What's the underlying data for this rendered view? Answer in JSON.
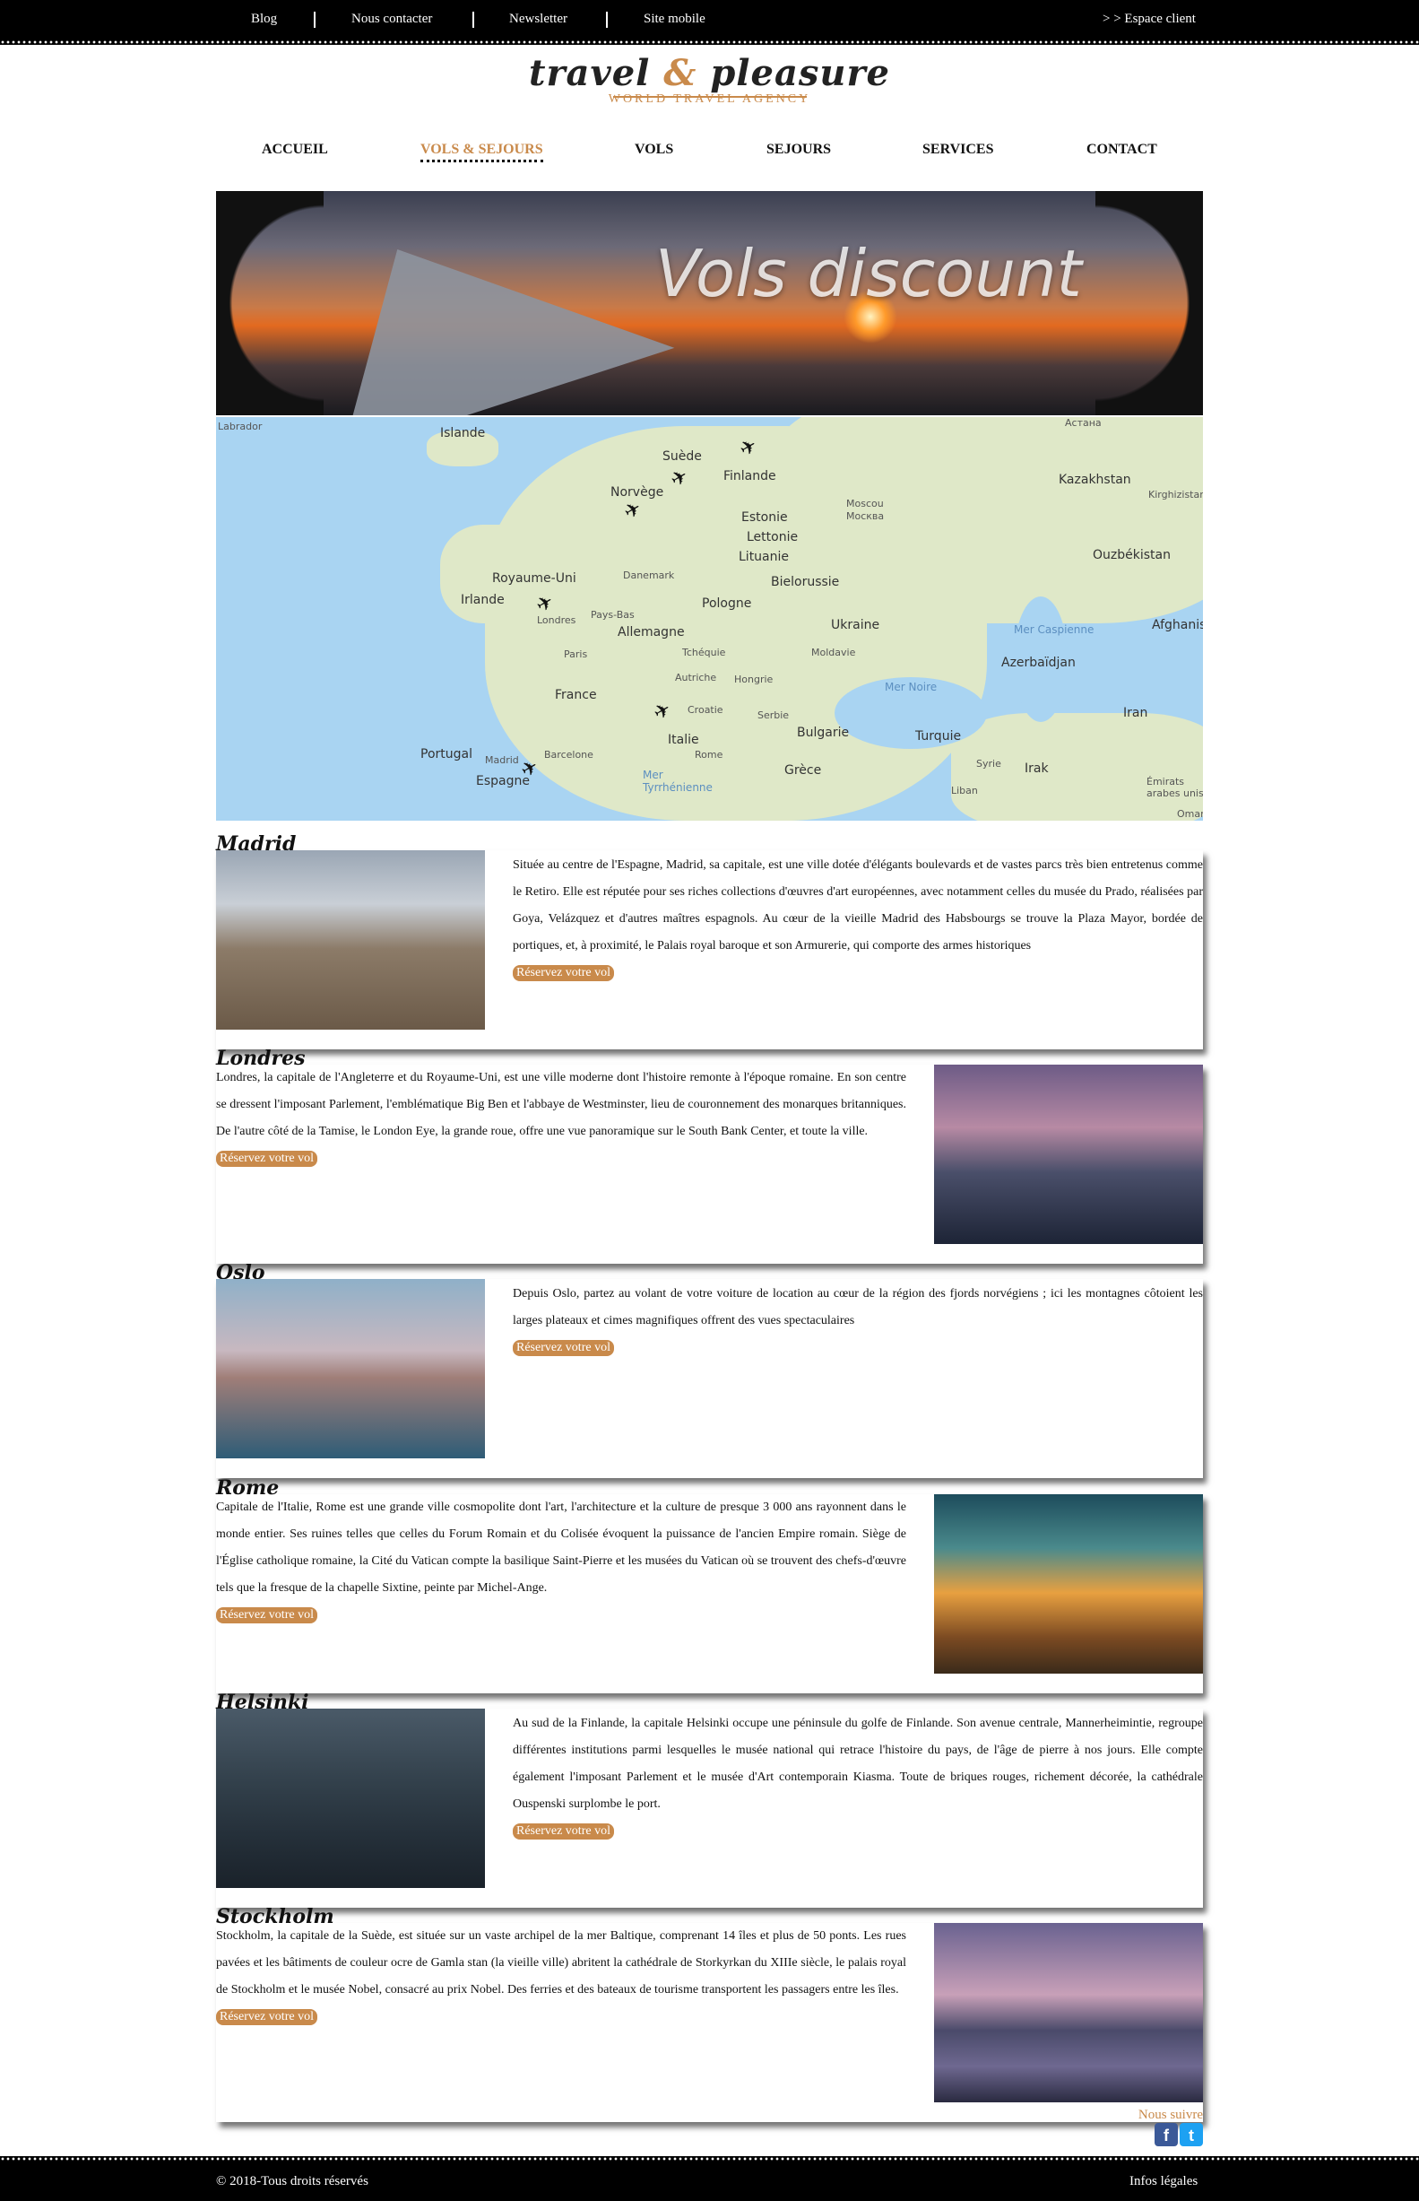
{
  "topbar": {
    "links": [
      "Blog",
      "Nous contacter",
      "Newsletter",
      "Site mobile"
    ],
    "client": "> > Espace client"
  },
  "logo": {
    "part1": "travel ",
    "amp": "&",
    "part2": " pleasure",
    "tagline": "WORLD TRAVEL AGENCY"
  },
  "nav": [
    "ACCUEIL",
    "VOLS & SEJOURS",
    "VOLS",
    "SEJOURS",
    "SERVICES",
    "CONTACT"
  ],
  "banner": {
    "title": "Vols discount"
  },
  "map": {
    "labels": [
      "Labrador",
      "Islande",
      "Suède",
      "Finlande",
      "Norvège",
      "Астана",
      "Kazakhstan",
      "Kirghizistan",
      "Moscou",
      "Москва",
      "Estonie",
      "Lettonie",
      "Lituanie",
      "Danemark",
      "Royaume-Uni",
      "Bielorussie",
      "Ouzbékistan",
      "Irlande",
      "Londres",
      "Pays-Bas",
      "Pologne",
      "Allemagne",
      "Ukraine",
      "Mer Caspienne",
      "Afghanistan",
      "Paris",
      "Tchéquie",
      "Moldavie",
      "Azerbaïdjan",
      "Autriche",
      "Hongrie",
      "France",
      "Mer Noire",
      "Croatie",
      "Serbie",
      "Iran",
      "Italie",
      "Bulgarie",
      "Turquie",
      "Portugal",
      "Madrid",
      "Barcelone",
      "Rome",
      "Syrie",
      "Irak",
      "Espagne",
      "Grèce",
      "Mer Tyrrhénienne",
      "Liban",
      "Émirats arabes unis",
      "Oman"
    ]
  },
  "button_label": "Réservez votre vol",
  "destinations": [
    {
      "name": "Madrid",
      "text": "Située au centre de l'Espagne, Madrid, sa capitale, est une ville dotée d'élégants boulevards et de vastes parcs très bien entretenus comme le Retiro. Elle est réputée pour ses riches collections d'œuvres d'art européennes, avec notamment celles du musée du Prado, réalisées par Goya, Velázquez et d'autres maîtres espagnols. Au cœur de la vieille Madrid des Habsbourgs se trouve la Plaza Mayor, bordée de portiques, et, à proximité, le Palais royal baroque et son Armurerie, qui comporte des armes historiques"
    },
    {
      "name": "Londres",
      "text": "Londres, la capitale de l'Angleterre et du Royaume-Uni, est une ville moderne dont l'histoire remonte à l'époque romaine. En son centre se dressent l'imposant Parlement, l'emblématique Big Ben et l'abbaye de Westminster, lieu de couronnement des monarques britanniques. De l'autre côté de la Tamise, le London Eye, la grande roue, offre une vue panoramique sur le South Bank Center, et toute la ville."
    },
    {
      "name": "Oslo",
      "text": "Depuis Oslo, partez au volant de votre voiture de location au cœur de la région des fjords norvégiens ; ici les montagnes côtoient les larges plateaux et cimes magnifiques offrent des vues spectaculaires"
    },
    {
      "name": "Rome",
      "text": "Capitale de l'Italie, Rome est une grande ville cosmopolite dont l'art, l'architecture et la culture de presque 3 000 ans rayonnent dans le monde entier. Ses ruines telles que celles du Forum Romain et du Colisée évoquent la puissance de l'ancien Empire romain. Siège de l'Église catholique romaine, la Cité du Vatican compte la basilique Saint-Pierre et les musées du Vatican où se trouvent des chefs-d'œuvre tels que la fresque de la chapelle Sixtine, peinte par Michel-Ange."
    },
    {
      "name": "Helsinki",
      "text": "Au sud de la Finlande, la capitale Helsinki occupe une péninsule du golfe de Finlande. Son avenue centrale, Mannerheimintie, regroupe différentes institutions parmi lesquelles le musée national qui retrace l'histoire du pays, de l'âge de pierre à nos jours. Elle compte également l'imposant Parlement et le musée d'Art contemporain Kiasma. Toute de briques rouges, richement décorée, la cathédrale Ouspenski surplombe le port."
    },
    {
      "name": "Stockholm",
      "text": "Stockholm, la capitale de la Suède, est située sur un vaste archipel de la mer Baltique, comprenant 14 îles et plus de 50 ponts. Les rues pavées et les bâtiments de couleur ocre de Gamla stan (la vieille ville) abritent la cathédrale de Storkyrkan du XIIIe siècle, le palais royal de Stockholm et le musée Nobel, consacré au prix Nobel. Des ferries et des bateaux de tourisme transportent les passagers entre les îles."
    }
  ],
  "follow": {
    "label": "Nous suivre",
    "facebook": "f",
    "twitter": "t"
  },
  "footer": {
    "copyright": "© 2018-Tous droits réservés",
    "legal": "Infos légales"
  },
  "colors": {
    "accent": "#c98a4b",
    "bar": "#000000"
  }
}
